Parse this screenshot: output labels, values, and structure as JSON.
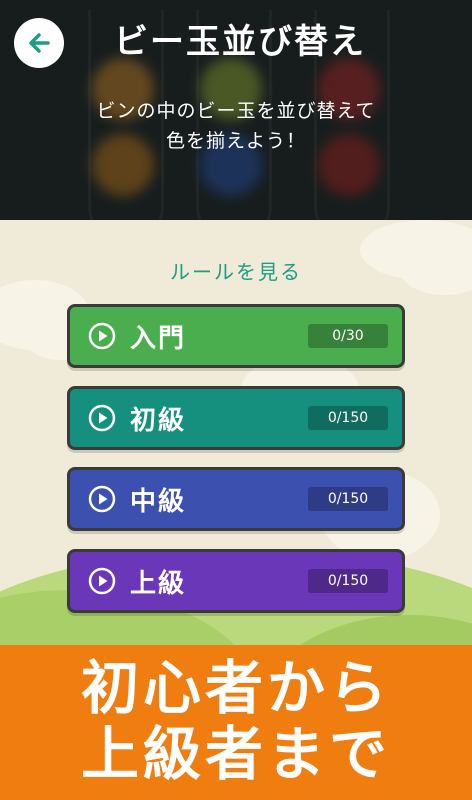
{
  "header": {
    "title": "ビー玉並び替え",
    "description_line1": "ビンの中のビー玉を並び替えて",
    "description_line2": "色を揃えよう！"
  },
  "icons": {
    "back": "arrow-left-icon",
    "play": "play-circle-icon"
  },
  "rules_link": "ルールを見る",
  "levels": [
    {
      "label": "入門",
      "progress": "0/30",
      "color": "#4aae4e"
    },
    {
      "label": "初級",
      "progress": "0/150",
      "color": "#16907e"
    },
    {
      "label": "中級",
      "progress": "0/150",
      "color": "#3c50b0"
    },
    {
      "label": "上級",
      "progress": "0/150",
      "color": "#6a37b8"
    }
  ],
  "banner": {
    "line1": "初心者から",
    "line2": "上級者まで"
  },
  "colors": {
    "accent_teal": "#1e9c84",
    "banner_orange": "#ef7d10",
    "header_dark": "#1d2323"
  }
}
